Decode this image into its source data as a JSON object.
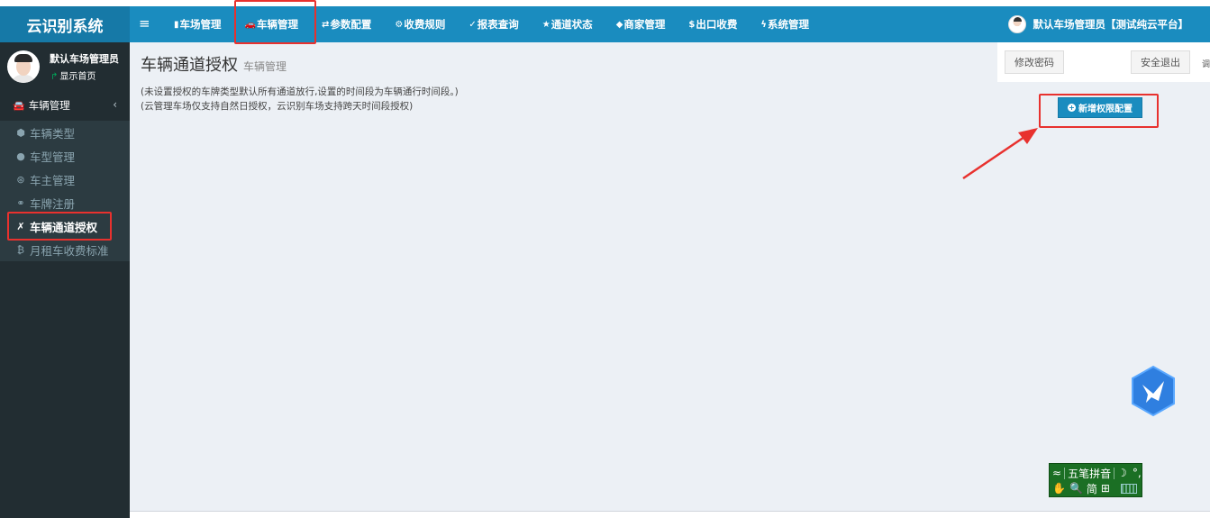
{
  "brand": "云识别系统",
  "nav": {
    "items": [
      {
        "icon": "▮",
        "label": "车场管理"
      },
      {
        "icon": "🚗",
        "label": "车辆管理"
      },
      {
        "icon": "⇄",
        "label": "参数配置"
      },
      {
        "icon": "⚙",
        "label": "收费规则"
      },
      {
        "icon": "✓",
        "label": "报表查询"
      },
      {
        "icon": "★",
        "label": "通道状态"
      },
      {
        "icon": "◆",
        "label": "商家管理"
      },
      {
        "icon": "$",
        "label": "出口收费"
      },
      {
        "icon": "ϟ",
        "label": "系统管理"
      }
    ],
    "user": "默认车场管理员【测试纯云平台】"
  },
  "sidebar": {
    "user_name": "默认车场管理员",
    "user_link": "显示首页",
    "menu_header": "车辆管理",
    "items": [
      {
        "icon": "⬢",
        "label": "车辆类型"
      },
      {
        "icon": "●",
        "label": "车型管理"
      },
      {
        "icon": "⊛",
        "label": "车主管理"
      },
      {
        "icon": "⚭",
        "label": "车牌注册"
      },
      {
        "icon": "✗",
        "label": "车辆通道授权"
      },
      {
        "icon": "₿",
        "label": "月租车收费标准"
      }
    ]
  },
  "content": {
    "title": "车辆通道授权",
    "subtitle": "车辆管理",
    "note1": "(未设置授权的车牌类型默认所有通道放行,设置的时间段为车辆通行时间段。)",
    "note2": "(云管理车场仅支持自然日授权，云识别车场支持跨天时间段授权)",
    "add_button": "新增权限配置"
  },
  "dropdown": {
    "change_password": "修改密码",
    "logout": "安全退出",
    "cut_text": "调"
  },
  "ime": {
    "row1": [
      "五笔拼音",
      "☽",
      "°,"
    ],
    "row2": [
      "✋",
      "🔍",
      "简",
      "⊞"
    ]
  },
  "colors": {
    "topbar": "#1a8cbf",
    "brand_bg": "#1679a7",
    "sidebar": "#222d32",
    "content_bg": "#ecf0f5",
    "highlight": "#e8312e"
  }
}
